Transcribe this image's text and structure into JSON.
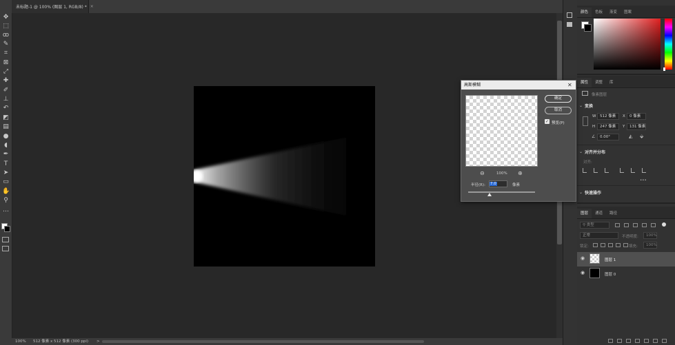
{
  "document": {
    "tab_title": "未标题-1 @ 100% (图层 1, RGB/8) *",
    "tab_close": "×"
  },
  "status_bar": {
    "zoom": "100%",
    "doc_info": "512 像素 x 512 像素 (300 ppi)",
    "arrow": ">"
  },
  "toolbar": {
    "tools": [
      {
        "icon": "move-icon",
        "glyph": "✥"
      },
      {
        "icon": "marquee-icon",
        "glyph": "⬚"
      },
      {
        "icon": "lasso-icon",
        "glyph": "ꝏ"
      },
      {
        "icon": "quick-select-icon",
        "glyph": "✎"
      },
      {
        "icon": "crop-icon",
        "glyph": "⌗"
      },
      {
        "icon": "frame-icon",
        "glyph": "⊠"
      },
      {
        "icon": "eyedropper-icon",
        "glyph": "⤢"
      },
      {
        "icon": "healing-brush-icon",
        "glyph": "✚"
      },
      {
        "icon": "brush-icon",
        "glyph": "✐"
      },
      {
        "icon": "stamp-icon",
        "glyph": "⊥"
      },
      {
        "icon": "history-brush-icon",
        "glyph": "↶"
      },
      {
        "icon": "eraser-icon",
        "glyph": "◩"
      },
      {
        "icon": "gradient-icon",
        "glyph": "▤"
      },
      {
        "icon": "blur-icon",
        "glyph": "●"
      },
      {
        "icon": "dodge-icon",
        "glyph": "◖"
      },
      {
        "icon": "pen-icon",
        "glyph": "✒"
      },
      {
        "icon": "type-icon",
        "glyph": "T"
      },
      {
        "icon": "path-select-icon",
        "glyph": "➤"
      },
      {
        "icon": "shape-icon",
        "glyph": "▭"
      },
      {
        "icon": "hand-icon",
        "glyph": "✋"
      },
      {
        "icon": "zoom-icon",
        "glyph": "⚲"
      },
      {
        "icon": "more-tools-icon",
        "glyph": "…"
      }
    ]
  },
  "color_panel": {
    "tabs": [
      "颜色",
      "色板",
      "渐变",
      "图案"
    ],
    "active_tab": 0
  },
  "properties_panel": {
    "tabs": [
      "属性",
      "调整",
      "库"
    ],
    "layer_type_label": "像素图层",
    "transform_title": "变换",
    "w_label": "W",
    "w_value": "512 像素",
    "x_label": "X",
    "x_value": "0 像素",
    "h_label": "H",
    "h_value": "247 像素",
    "y_label": "Y",
    "y_value": "131 像素",
    "angle_value": "0.00°",
    "align_title": "对齐并分布",
    "align_label": "对齐:",
    "more": "•••",
    "quick_actions_title": "快速操作"
  },
  "layers_panel": {
    "tabs": [
      "图层",
      "通道",
      "路径"
    ],
    "filter_label": "类型",
    "blend_mode": "正常",
    "opacity_label": "不透明度:",
    "opacity_value": "100%",
    "lock_label": "锁定:",
    "fill_label": "填充:",
    "fill_value": "100%",
    "layers": [
      {
        "name": "图层 1",
        "selected": true,
        "thumb": "transparent"
      },
      {
        "name": "图层 0",
        "selected": false,
        "thumb": "black"
      }
    ]
  },
  "gaussian_blur_dialog": {
    "title": "高斯模糊",
    "ok_label": "确定",
    "cancel_label": "取消",
    "preview_label": "预览(P)",
    "preview_checked": true,
    "zoom_value": "100%",
    "radius_label": "半径(R):",
    "radius_value": "7.0",
    "radius_unit": "像素"
  }
}
